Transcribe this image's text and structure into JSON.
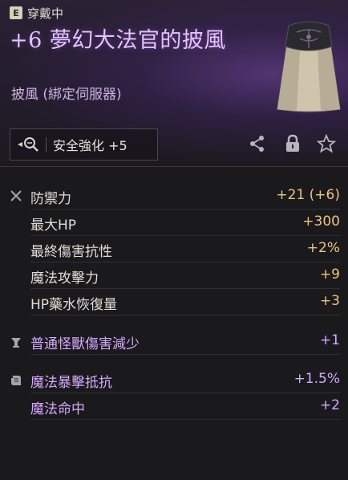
{
  "header": {
    "equip_badge": "E",
    "equip_status": "穿戴中",
    "item_name": "+6 夢幻大法官的披風",
    "item_type": "披風 (綁定伺服器)",
    "enhance_label": "安全強化 +5"
  },
  "stats_base": [
    {
      "label": "防禦力",
      "value": "+21 (+6)"
    },
    {
      "label": "最大HP",
      "value": "+300"
    },
    {
      "label": "最終傷害抗性",
      "value": "+2%"
    },
    {
      "label": "魔法攻擊力",
      "value": "+9"
    },
    {
      "label": "HP藥水恢復量",
      "value": "+3"
    }
  ],
  "stats_group2": [
    {
      "label": "普通怪獸傷害減少",
      "value": "+1"
    }
  ],
  "stats_group3": [
    {
      "label": "魔法暴擊抵抗",
      "value": "+1.5%"
    },
    {
      "label": "魔法命中",
      "value": "+2"
    }
  ],
  "colors": {
    "name_purple": "#e6c2ff",
    "stat_gold": "#f0c47a",
    "stat_purple": "#d6a8ff"
  },
  "icons": [
    "magnifier-icon",
    "share-icon",
    "lock-icon",
    "star-icon",
    "crossed-swords-icon",
    "chalice-icon",
    "scroll-icon"
  ]
}
